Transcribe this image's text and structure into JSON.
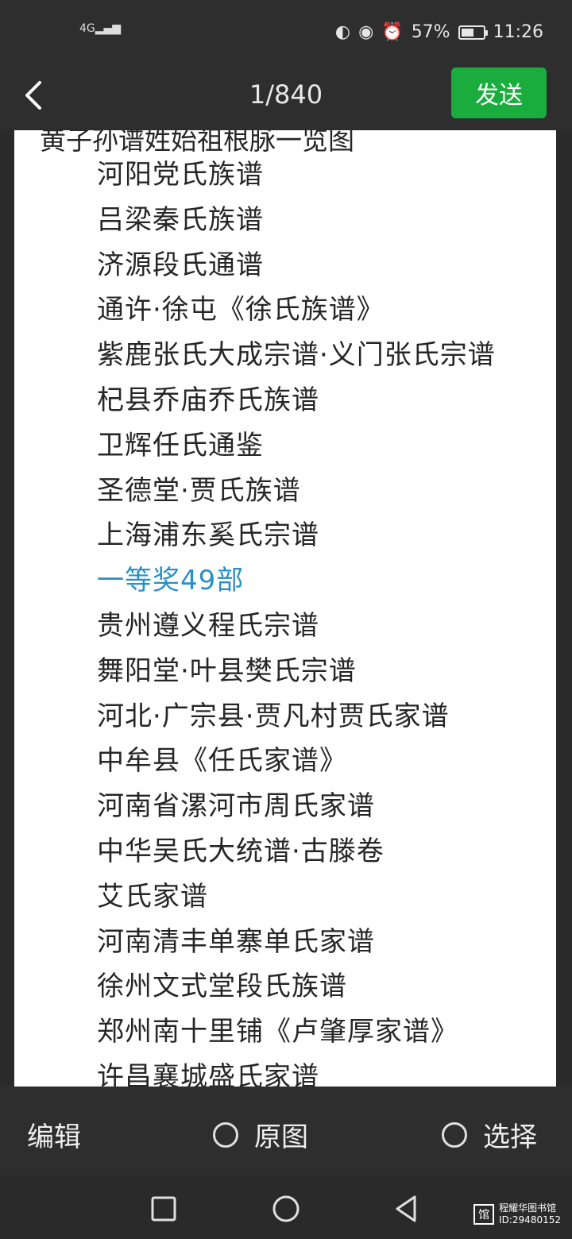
{
  "status_bar": {
    "network": "4G",
    "battery": "57%",
    "battery_level": 0.57,
    "time": "11:26"
  },
  "top_bar": {
    "counter": "1/840",
    "send_label": "发送"
  },
  "document": {
    "cut_off_top_line": "黄子孙谱姓始祖根脉一览图",
    "items": [
      {
        "text": "河阳党氏族谱",
        "highlight": false
      },
      {
        "text": "吕梁秦氏族谱",
        "highlight": false
      },
      {
        "text": "济源段氏通谱",
        "highlight": false
      },
      {
        "text": "通许·徐屯《徐氏族谱》",
        "highlight": false
      },
      {
        "text": "紫鹿张氏大成宗谱·义门张氏宗谱",
        "highlight": false
      },
      {
        "text": "杞县乔庙乔氏族谱",
        "highlight": false
      },
      {
        "text": "卫辉任氏通鉴",
        "highlight": false
      },
      {
        "text": "圣德堂·贾氏族谱",
        "highlight": false
      },
      {
        "text": "上海浦东奚氏宗谱",
        "highlight": false
      },
      {
        "text": "一等奖49部",
        "highlight": true
      },
      {
        "text": "贵州遵义程氏宗谱",
        "highlight": false
      },
      {
        "text": "舞阳堂·叶县樊氏宗谱",
        "highlight": false
      },
      {
        "text": "河北·广宗县·贾凡村贾氏家谱",
        "highlight": false
      },
      {
        "text": "中牟县《任氏家谱》",
        "highlight": false
      },
      {
        "text": "河南省漯河市周氏家谱",
        "highlight": false
      },
      {
        "text": "中华吴氏大统谱·古滕卷",
        "highlight": false
      },
      {
        "text": "艾氏家谱",
        "highlight": false
      },
      {
        "text": "河南清丰单寨单氏家谱",
        "highlight": false
      },
      {
        "text": "徐州文式堂段氏族谱",
        "highlight": false
      },
      {
        "text": "郑州南十里铺《卢肇厚家谱》",
        "highlight": false
      },
      {
        "text": "许昌襄城盛氏家谱",
        "highlight": false
      }
    ]
  },
  "bottom_bar": {
    "edit_label": "编辑",
    "original_label": "原图",
    "select_label": "选择"
  },
  "watermark": {
    "line1": "程耀华图书馆",
    "line2": "ID:29480152"
  },
  "colors": {
    "send_button": "#1aad3e",
    "highlight_text": "#2a8fc4",
    "bars": "#2e2e2e"
  }
}
